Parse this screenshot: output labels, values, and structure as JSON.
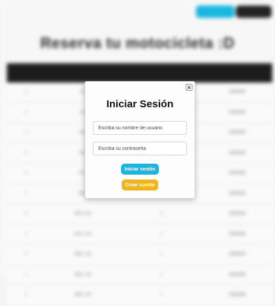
{
  "header": {
    "buttons": [
      {
        "label": "",
        "color": "#18b7e0"
      },
      {
        "label": "",
        "color": "#222222"
      }
    ]
  },
  "page": {
    "title": "Reserva tu motocicleta :D",
    "table": {
      "rows": [
        {
          "c0": "1",
          "c1": "123",
          "c2": "",
          "c3": "BBBBBB"
        },
        {
          "c0": "1",
          "c1": "123",
          "c2": "",
          "c3": "BBBBBB"
        },
        {
          "c0": "1",
          "c1": "ABC",
          "c2": "",
          "c3": "BBBBBB"
        },
        {
          "c0": "1",
          "c1": "CDF",
          "c2": "",
          "c3": "BBBBBB"
        },
        {
          "c0": "1",
          "c1": "EFG",
          "c2": "",
          "c3": "BBBBBB"
        },
        {
          "c0": "1",
          "c1": "BDG",
          "c2": "",
          "c3": "BBBBBB"
        },
        {
          "c0": "1",
          "c1": "BDE 126",
          "c2": "1",
          "c3": "BBBBBB"
        },
        {
          "c0": "1",
          "c1": "EDU 126",
          "c2": "1",
          "c3": "BBBBBB"
        },
        {
          "c0": "1",
          "c1": "BBE 126",
          "c2": "1",
          "c3": "BBBBBB"
        },
        {
          "c0": "1",
          "c1": "BBE 126",
          "c2": "1",
          "c3": "BBBBBB"
        },
        {
          "c0": "1",
          "c1": "BBE 126",
          "c2": "1",
          "c3": "BBBBBB"
        }
      ]
    }
  },
  "modal": {
    "close_label": "×",
    "title": "Iniciar Sesión",
    "username_placeholder": "Escriba su nombre de usuario",
    "password_placeholder": "Escriba su contraseña",
    "login_label": "Iniciar sesión",
    "register_label": "Crear cuenta",
    "colors": {
      "login": "#1bb4de",
      "register": "#f0b51a"
    }
  }
}
